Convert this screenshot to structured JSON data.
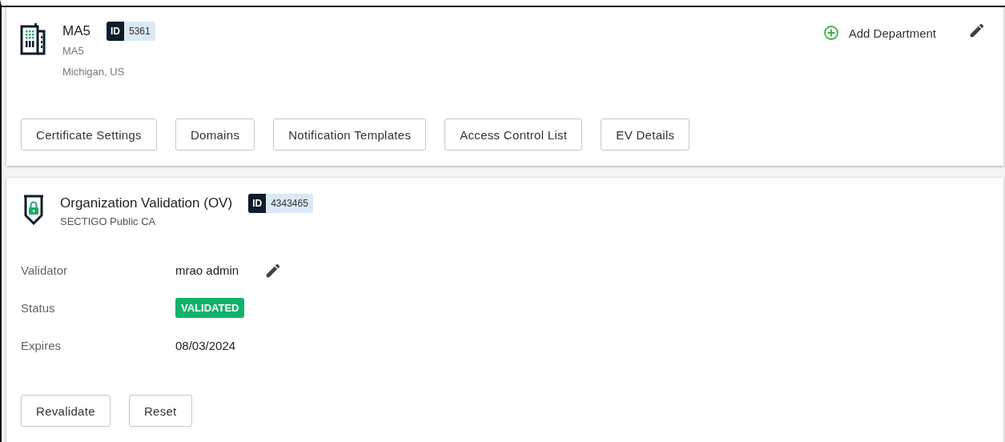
{
  "department": {
    "name": "MA5",
    "id_label": "ID",
    "id": "5361",
    "subtitle": "MA5",
    "location": "Michigan, US",
    "add_action": "Add Department",
    "buttons": [
      "Certificate Settings",
      "Domains",
      "Notification Templates",
      "Access Control List",
      "EV Details"
    ]
  },
  "validation": {
    "title": "Organization Validation (OV)",
    "id_label": "ID",
    "id": "4343465",
    "subtitle": "SECTIGO Public CA",
    "fields": [
      {
        "kind": "editable",
        "label": "Validator",
        "value": "mrao admin"
      },
      {
        "kind": "status",
        "label": "Status",
        "value": "VALIDATED"
      },
      {
        "kind": "text",
        "label": "Expires",
        "value": "08/03/2024"
      }
    ],
    "buttons": [
      "Revalidate",
      "Reset"
    ]
  }
}
